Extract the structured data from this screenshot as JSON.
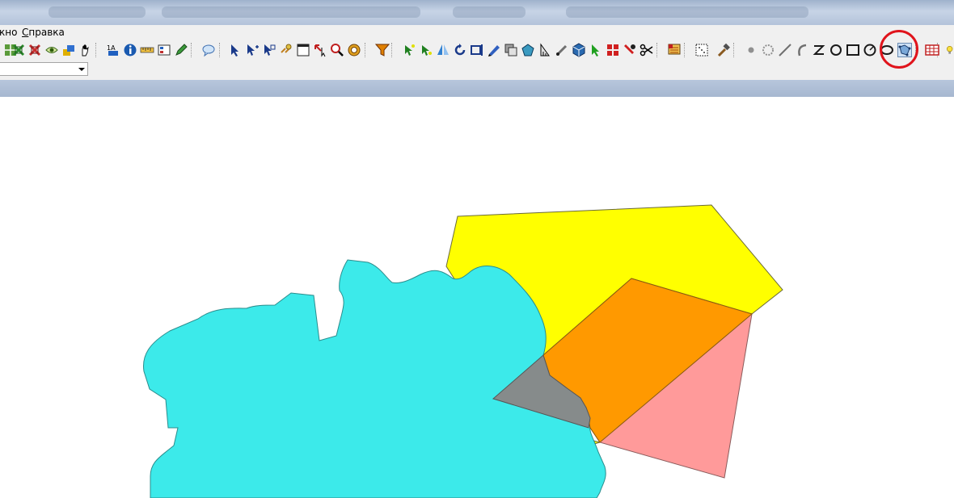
{
  "menubar": {
    "items": [
      {
        "label": "кно",
        "underline": ""
      },
      {
        "label": "правка",
        "underline": "С"
      }
    ]
  },
  "toolbar": {
    "tools": [
      "grid-icon",
      "zoom-extent-icon",
      "zoom-box-icon",
      "eye-icon",
      "layers-icon",
      "hand-pan-icon",
      "identify-icon",
      "info-icon",
      "ruler-icon",
      "legend-icon",
      "pen-icon",
      "chat-icon",
      "arrow-select-icon",
      "arrow-select-plus-icon",
      "arrow-select-multi-icon",
      "hyperlink-icon",
      "window-icon",
      "cursor-drag-icon",
      "magnifier-icon",
      "target-icon",
      "filter-icon",
      "node-edit-icon",
      "node-add-icon",
      "mirror-icon",
      "rotate-icon",
      "frame-icon",
      "pencil-select-icon",
      "overlap-icon",
      "polygon-icon",
      "measure-icon",
      "brush-icon",
      "cube-icon",
      "arrow-green-icon",
      "grid-red-icon",
      "pin-red-icon",
      "scissors-icon",
      "layer-settings-icon",
      "dots-box-icon",
      "hammer-icon",
      "point-icon",
      "star-icon",
      "line-icon",
      "arc-icon",
      "polyline-icon",
      "circle-icon",
      "rectangle-icon",
      "ellipse-icon",
      "ellipse-alt-icon",
      "snap-polygon-icon",
      "table-icon",
      "lightbulb-icon"
    ],
    "highlighted_tool": "snap-polygon-icon"
  },
  "combo": {
    "value": ""
  },
  "colors": {
    "cyan_region": "#3ceaea",
    "yellow_region": "#ffff00",
    "orange_overlap": "#ff9900",
    "pink_region": "#ff9a9a",
    "gray_overlap": "#868b8b",
    "highlight": "#e0141c"
  }
}
